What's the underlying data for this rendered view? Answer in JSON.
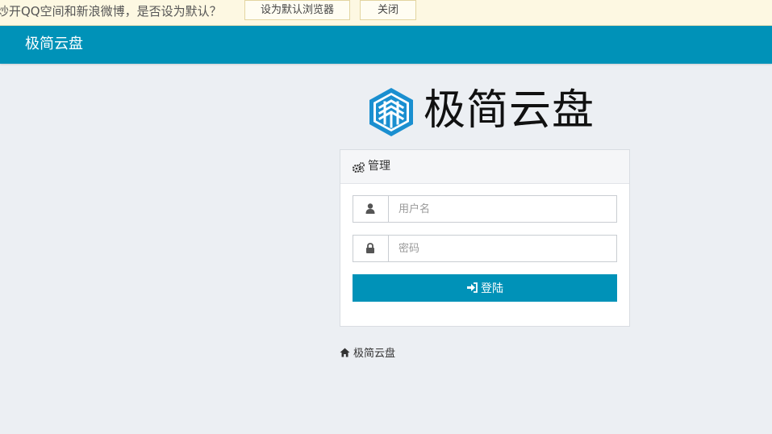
{
  "notification": {
    "message": "炒开QQ空间和新浪微博，是否设为默认？",
    "set_default_label": "设为默认浏览器",
    "close_label": "关闭"
  },
  "navbar": {
    "brand": "极简云盘"
  },
  "logo": {
    "text": "极简云盘"
  },
  "login_panel": {
    "title": "管理",
    "username_placeholder": "用户名",
    "password_placeholder": "密码",
    "submit_label": "登陆"
  },
  "footer": {
    "home_link": "极简云盘"
  },
  "colors": {
    "accent": "#0092b8",
    "notification_bg": "#fdf8e2",
    "page_bg": "#eceff3",
    "logo_blue": "#1a8fd0"
  },
  "icons": {
    "panel_title": "gears-icon",
    "username": "user-icon",
    "password": "lock-icon",
    "submit": "sign-in-icon",
    "footer": "home-icon"
  }
}
